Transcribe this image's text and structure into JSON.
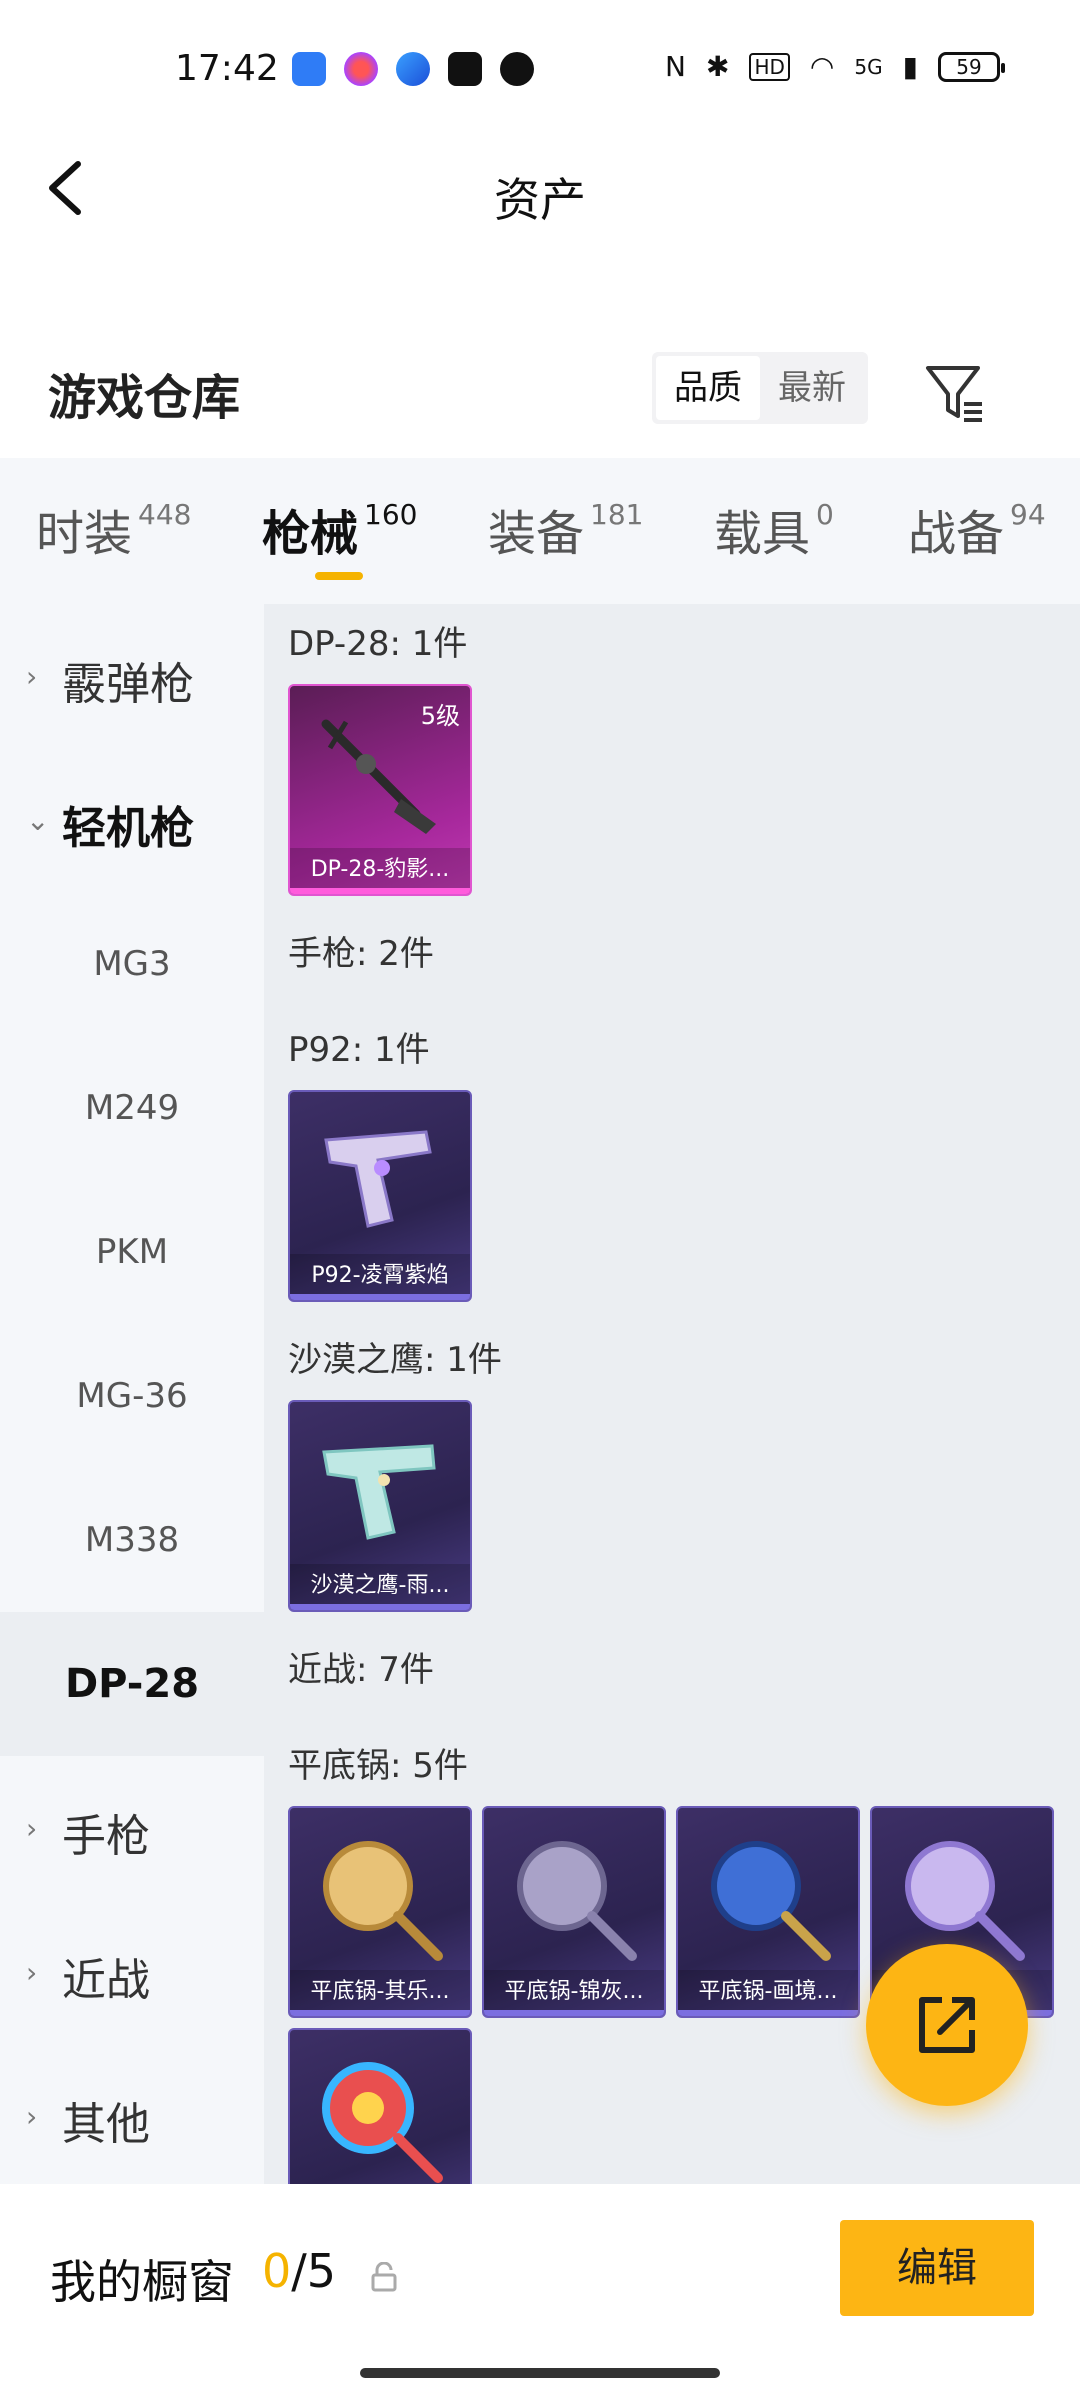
{
  "status_bar": {
    "time": "17:42",
    "signal": "5G",
    "hd": "HD",
    "battery": "59",
    "app_icons": [
      "app-icon-blue",
      "app-icon-flower",
      "app-icon-browser",
      "tiktok-icon",
      "wechat-icon"
    ]
  },
  "header": {
    "title": "资产",
    "back_icon": "chevron-left-icon"
  },
  "warehouse": {
    "title": "游戏仓库",
    "sort_options": [
      "品质",
      "最新"
    ],
    "sort_active": "品质",
    "filter_icon": "filter-icon"
  },
  "tabs": [
    {
      "label": "时装",
      "count": "448"
    },
    {
      "label": "枪械",
      "count": "160",
      "active": true
    },
    {
      "label": "装备",
      "count": "181"
    },
    {
      "label": "载具",
      "count": "0"
    },
    {
      "label": "战备",
      "count": "94"
    }
  ],
  "sidenav": {
    "categories": [
      {
        "label": "霰弹枪",
        "expanded": false
      },
      {
        "label": "轻机枪",
        "expanded": true
      },
      {
        "label": "手枪",
        "expanded": false
      },
      {
        "label": "近战",
        "expanded": false
      },
      {
        "label": "其他",
        "expanded": false
      }
    ],
    "subitems": [
      "MG3",
      "M249",
      "PKM",
      "MG-36",
      "M338",
      "DP-28"
    ],
    "active_subitem": "DP-28"
  },
  "content": {
    "sections": [
      {
        "title": "DP-28: 1件",
        "items": [
          {
            "name": "DP-28-豹影...",
            "level": "5级",
            "rarity": "pink",
            "icon": "rifle-icon"
          }
        ]
      },
      {
        "title": "手枪: 2件"
      },
      {
        "title": "P92: 1件",
        "items": [
          {
            "name": "P92-凌霄紫焰",
            "rarity": "purple",
            "icon": "pistol-icon"
          }
        ]
      },
      {
        "title": "沙漠之鹰: 1件",
        "items": [
          {
            "name": "沙漠之鹰-雨...",
            "rarity": "purple",
            "icon": "pistol-icon"
          }
        ]
      },
      {
        "title": "近战: 7件"
      },
      {
        "title": "平底锅: 5件",
        "items": [
          {
            "name": "平底锅-其乐...",
            "rarity": "purple",
            "icon": "pan-icon"
          },
          {
            "name": "平底锅-锦灰...",
            "rarity": "purple",
            "icon": "pan-icon"
          },
          {
            "name": "平底锅-画境...",
            "rarity": "purple",
            "icon": "pan-icon"
          },
          {
            "name": "",
            "rarity": "purple",
            "icon": "pan-icon"
          },
          {
            "name": "",
            "rarity": "purple",
            "icon": "pan-icon"
          }
        ]
      }
    ]
  },
  "fab": {
    "icon": "share-external-icon"
  },
  "bottom_bar": {
    "label": "我的橱窗",
    "count_current": "0",
    "count_sep": "/",
    "count_total": "5",
    "lock_icon": "lock-icon",
    "edit_label": "编辑"
  },
  "colors": {
    "accent": "#fdb514",
    "page_bg": "#ebeef2",
    "nav_bg": "#f5f7fa",
    "rarity_purple": "#6a5bb8",
    "rarity_pink": "#e055d0"
  }
}
